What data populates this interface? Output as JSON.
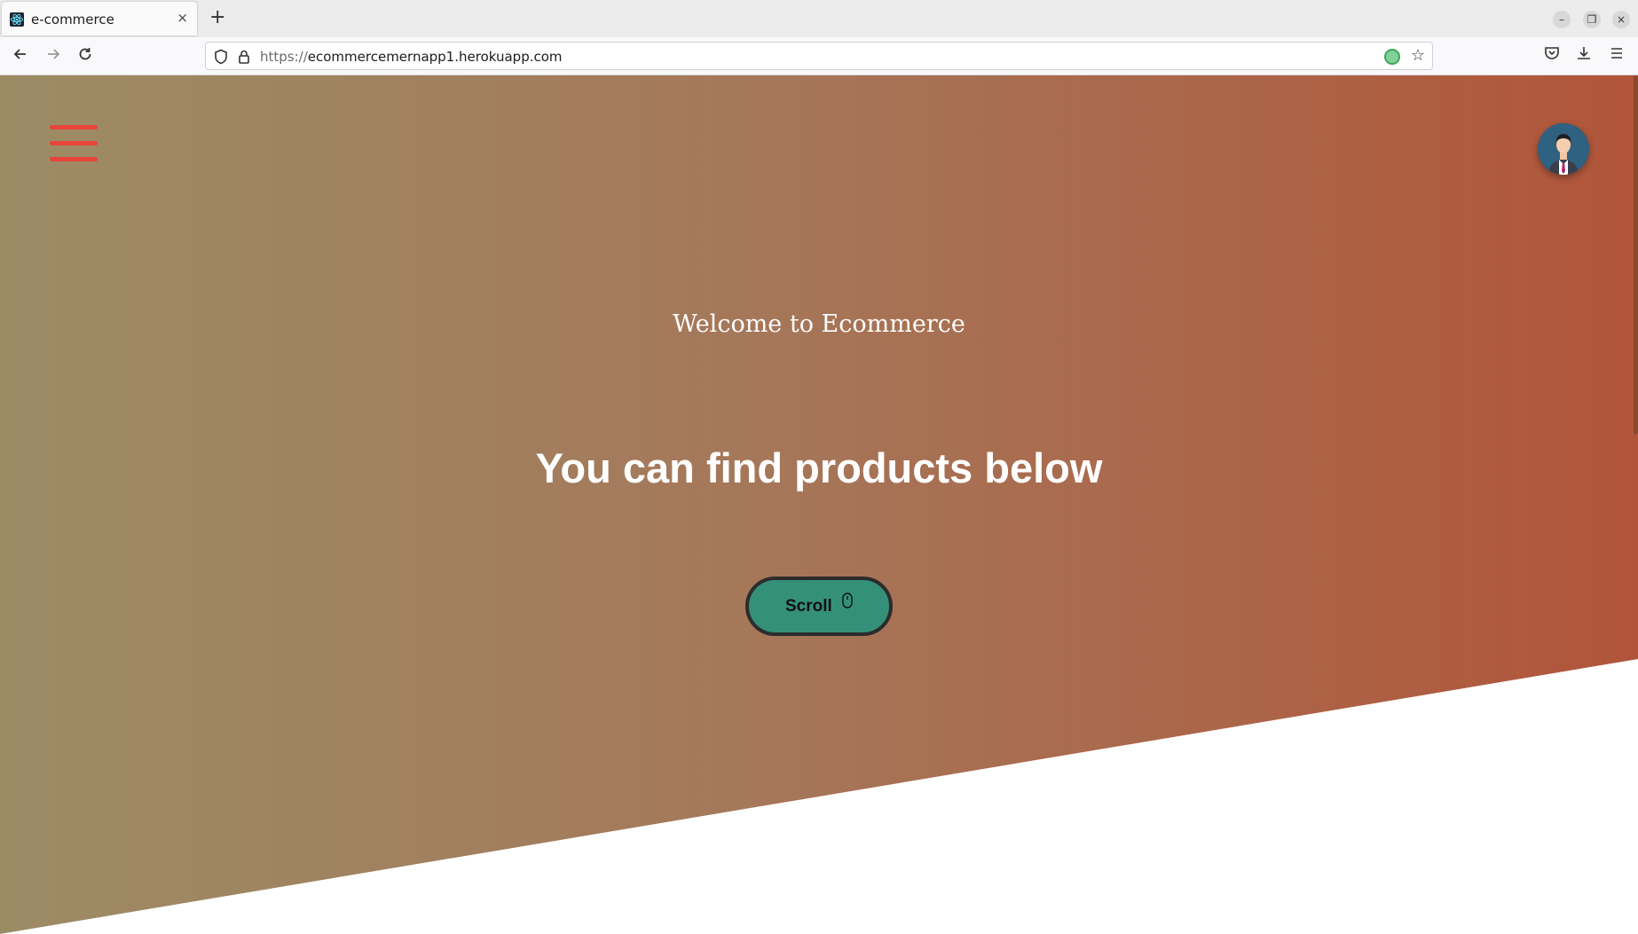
{
  "browser": {
    "tab_title": "e-commerce",
    "tab_close": "×",
    "new_tab": "+",
    "url_protocol": "https://",
    "url_host": "ecommercemernapp1.herokuapp.com",
    "window_controls": {
      "minimize": "–",
      "restore": "❐",
      "close": "×"
    }
  },
  "hero": {
    "welcome_text": "Welcome to Ecommerce",
    "headline": "You can find products below",
    "scroll_button_label": "Scroll",
    "gradient_colors": [
      "#9c8c66",
      "#a5785a",
      "#b1553a"
    ],
    "menu_icon_color": "#e8443a",
    "button_color": "#35907a"
  }
}
